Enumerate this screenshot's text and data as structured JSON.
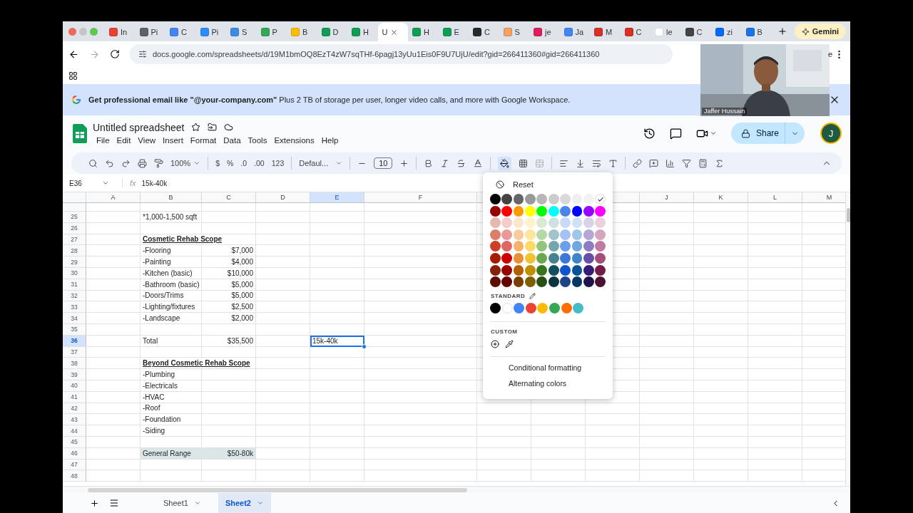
{
  "tabs": [
    {
      "label": "In",
      "color": "#ea4335",
      "selected": false
    },
    {
      "label": "Pi",
      "color": "#5f6368",
      "selected": false
    },
    {
      "label": "C",
      "color": "#4285f4",
      "selected": false
    },
    {
      "label": "Pi",
      "color": "#2d8cff",
      "selected": false
    },
    {
      "label": "S",
      "color": "#3c8ce7",
      "selected": false
    },
    {
      "label": "P",
      "color": "#34a853",
      "selected": false
    },
    {
      "label": "B",
      "color": "#fbbc04",
      "selected": false
    },
    {
      "label": "D",
      "color": "#0f9d58",
      "selected": false
    },
    {
      "label": "H",
      "color": "#0f9d58",
      "selected": false
    },
    {
      "label": "U",
      "selected": true
    },
    {
      "label": "H",
      "color": "#0f9d58",
      "selected": false
    },
    {
      "label": "E",
      "color": "#0f9d58",
      "selected": false
    },
    {
      "label": "C",
      "color": "#2a2a2a",
      "selected": false
    },
    {
      "label": "S",
      "color": "#f4a261",
      "selected": false
    },
    {
      "label": "je",
      "color": "#e01e5a",
      "selected": false
    },
    {
      "label": "Ja",
      "color": "#4285f4",
      "selected": false
    },
    {
      "label": "M",
      "color": "#d93025",
      "selected": false
    },
    {
      "label": "C",
      "color": "#d93025",
      "selected": false
    },
    {
      "label": "le",
      "color": "#ffffff",
      "selected": false
    },
    {
      "label": "C",
      "color": "#444444",
      "selected": false
    },
    {
      "label": "zi",
      "color": "#006aff",
      "selected": false
    },
    {
      "label": "B",
      "color": "#1a73e8",
      "selected": false
    }
  ],
  "gemini": "Gemini",
  "address_bar": {
    "url": "docs.google.com/spreadsheets/d/19M1bmOQ8EzT4zW7sqTHf-6pagj13yUu1Eis0F9U7UjU/edit?gid=266411360#gid=266411360",
    "chip_fragment": "e"
  },
  "banner": {
    "text": "**Get professional email like \"@your-company.com\"** Plus 2 TB of storage per user, longer video calls, and more with Google Workspace."
  },
  "video": {
    "name": "Jaffer Hussain"
  },
  "document": {
    "title": "Untitled spreadsheet",
    "menu": [
      "File",
      "Edit",
      "View",
      "Insert",
      "Format",
      "Data",
      "Tools",
      "Extensions",
      "Help"
    ],
    "share": "Share",
    "avatar": "J"
  },
  "toolbar": {
    "zoom": "100%",
    "currency": "$",
    "percent": "%",
    "decrease_decimals": ".0",
    "increase_decimals": ".00",
    "number_format": "123",
    "font": "Defaul...",
    "font_size": "10",
    "fill_menu_open": true
  },
  "formula_bar": {
    "cell": "E36",
    "fx": "fx",
    "value": "15k-40k"
  },
  "columns": [
    {
      "label": "A",
      "selected": false
    },
    {
      "label": "B",
      "selected": false
    },
    {
      "label": "C",
      "selected": false
    },
    {
      "label": "D",
      "selected": false
    },
    {
      "label": "E",
      "selected": true
    },
    {
      "label": "F",
      "selected": false
    },
    null,
    null,
    null,
    {
      "label": "J",
      "selected": false
    },
    {
      "label": "K",
      "selected": false
    },
    {
      "label": "L",
      "selected": false
    },
    {
      "label": "M",
      "selected": false
    }
  ],
  "rows": [
    {
      "number": "25",
      "selected": false,
      "cells": [
        null,
        {
          "text": "*1,000-1,500 sqft",
          "kind": "text",
          "shaded": false,
          "selected": false
        }
      ]
    },
    {
      "number": "26",
      "selected": false,
      "cells": []
    },
    {
      "number": "27",
      "selected": false,
      "cells": [
        null,
        {
          "text": "Cosmetic Rehab Scope",
          "kind": "heading",
          "shaded": false,
          "selected": false
        }
      ]
    },
    {
      "number": "28",
      "selected": false,
      "cells": [
        null,
        {
          "text": "-Flooring",
          "kind": "text",
          "shaded": false,
          "selected": false
        },
        {
          "text": "$7,000",
          "kind": "number",
          "shaded": false,
          "selected": false
        }
      ]
    },
    {
      "number": "29",
      "selected": false,
      "cells": [
        null,
        {
          "text": "-Painting",
          "kind": "text",
          "shaded": false,
          "selected": false
        },
        {
          "text": "$4,000",
          "kind": "number",
          "shaded": false,
          "selected": false
        }
      ]
    },
    {
      "number": "30",
      "selected": false,
      "cells": [
        null,
        {
          "text": "-Kitchen (basic)",
          "kind": "text",
          "shaded": false,
          "selected": false
        },
        {
          "text": "$10,000",
          "kind": "number",
          "shaded": false,
          "selected": false
        }
      ]
    },
    {
      "number": "31",
      "selected": false,
      "cells": [
        null,
        {
          "text": "-Bathroom (basic)",
          "kind": "text",
          "shaded": false,
          "selected": false
        },
        {
          "text": "$5,000",
          "kind": "number",
          "shaded": false,
          "selected": false
        }
      ]
    },
    {
      "number": "32",
      "selected": false,
      "cells": [
        null,
        {
          "text": "-Doors/Trims",
          "kind": "text",
          "shaded": false,
          "selected": false
        },
        {
          "text": "$5,000",
          "kind": "number",
          "shaded": false,
          "selected": false
        }
      ]
    },
    {
      "number": "33",
      "selected": false,
      "cells": [
        null,
        {
          "text": "-Lighting/fixtures",
          "kind": "text",
          "shaded": false,
          "selected": false
        },
        {
          "text": "$2,500",
          "kind": "number",
          "shaded": false,
          "selected": false
        }
      ]
    },
    {
      "number": "34",
      "selected": false,
      "cells": [
        null,
        {
          "text": "-Landscape",
          "kind": "text",
          "shaded": false,
          "selected": false
        },
        {
          "text": "$2,000",
          "kind": "number",
          "shaded": false,
          "selected": false
        }
      ]
    },
    {
      "number": "35",
      "selected": false,
      "cells": []
    },
    {
      "number": "36",
      "selected": true,
      "cells": [
        null,
        {
          "text": "Total",
          "kind": "text",
          "shaded": false,
          "selected": false
        },
        {
          "text": "$35,500",
          "kind": "number",
          "shaded": false,
          "selected": false
        },
        null,
        {
          "text": "15k-40k",
          "kind": "text",
          "shaded": false,
          "selected": true
        }
      ]
    },
    {
      "number": "37",
      "selected": false,
      "cells": []
    },
    {
      "number": "38",
      "selected": false,
      "cells": [
        null,
        {
          "text": "Beyond Cosmetic Rehab Scope",
          "kind": "heading",
          "shaded": false,
          "selected": false
        }
      ]
    },
    {
      "number": "39",
      "selected": false,
      "cells": [
        null,
        {
          "text": "-Plumbing",
          "kind": "text",
          "shaded": false,
          "selected": false
        }
      ]
    },
    {
      "number": "40",
      "selected": false,
      "cells": [
        null,
        {
          "text": "-Electricals",
          "kind": "text",
          "shaded": false,
          "selected": false
        }
      ]
    },
    {
      "number": "41",
      "selected": false,
      "cells": [
        null,
        {
          "text": "-HVAC",
          "kind": "text",
          "shaded": false,
          "selected": false
        }
      ]
    },
    {
      "number": "42",
      "selected": false,
      "cells": [
        null,
        {
          "text": "-Roof",
          "kind": "text",
          "shaded": false,
          "selected": false
        }
      ]
    },
    {
      "number": "43",
      "selected": false,
      "cells": [
        null,
        {
          "text": "-Foundation",
          "kind": "text",
          "shaded": false,
          "selected": false
        }
      ]
    },
    {
      "number": "44",
      "selected": false,
      "cells": [
        null,
        {
          "text": "-Siding",
          "kind": "text",
          "shaded": false,
          "selected": false
        }
      ]
    },
    {
      "number": "45",
      "selected": false,
      "cells": []
    },
    {
      "number": "46",
      "selected": false,
      "cells": [
        null,
        {
          "text": "General Range",
          "kind": "text",
          "shaded": true,
          "selected": false
        },
        {
          "text": "$50-80k",
          "kind": "number",
          "shaded": true,
          "selected": false
        }
      ]
    },
    {
      "number": "47",
      "selected": false,
      "cells": []
    },
    {
      "number": "48",
      "selected": false,
      "cells": []
    }
  ],
  "palette": {
    "reset": "Reset",
    "rows": [
      [
        {
          "color": "#000000",
          "selected": false
        },
        {
          "color": "#434343",
          "selected": false
        },
        {
          "color": "#666666",
          "selected": false
        },
        {
          "color": "#999999",
          "selected": false
        },
        {
          "color": "#b7b7b7",
          "selected": false
        },
        {
          "color": "#cccccc",
          "selected": false
        },
        {
          "color": "#d9d9d9",
          "selected": false
        },
        {
          "color": "#efefef",
          "selected": false
        },
        {
          "color": "#f3f3f3",
          "selected": false
        },
        {
          "color": "#ffffff",
          "selected": true
        }
      ],
      [
        {
          "color": "#980000",
          "selected": false
        },
        {
          "color": "#ff0000",
          "selected": false
        },
        {
          "color": "#ff9900",
          "selected": false
        },
        {
          "color": "#ffff00",
          "selected": false
        },
        {
          "color": "#00ff00",
          "selected": false
        },
        {
          "color": "#00ffff",
          "selected": false
        },
        {
          "color": "#4a86e8",
          "selected": false
        },
        {
          "color": "#0000ff",
          "selected": false
        },
        {
          "color": "#9900ff",
          "selected": false
        },
        {
          "color": "#ff00ff",
          "selected": false
        }
      ],
      [
        {
          "color": "#e6b8af",
          "selected": false
        },
        {
          "color": "#f4cccc",
          "selected": false
        },
        {
          "color": "#fce5cd",
          "selected": false
        },
        {
          "color": "#fff2cc",
          "selected": false
        },
        {
          "color": "#d9ead3",
          "selected": false
        },
        {
          "color": "#d0e0e3",
          "selected": false
        },
        {
          "color": "#c9daf8",
          "selected": false
        },
        {
          "color": "#cfe2f3",
          "selected": false
        },
        {
          "color": "#d9d2e9",
          "selected": false
        },
        {
          "color": "#ead1dc",
          "selected": false
        }
      ],
      [
        {
          "color": "#dd7e6b",
          "selected": false
        },
        {
          "color": "#ea9999",
          "selected": false
        },
        {
          "color": "#f9cb9c",
          "selected": false
        },
        {
          "color": "#ffe599",
          "selected": false
        },
        {
          "color": "#b6d7a8",
          "selected": false
        },
        {
          "color": "#a2c4c9",
          "selected": false
        },
        {
          "color": "#a4c2f4",
          "selected": false
        },
        {
          "color": "#9fc5e8",
          "selected": false
        },
        {
          "color": "#b4a7d6",
          "selected": false
        },
        {
          "color": "#d5a6bd",
          "selected": false
        }
      ],
      [
        {
          "color": "#cc4125",
          "selected": false
        },
        {
          "color": "#e06666",
          "selected": false
        },
        {
          "color": "#f6b26b",
          "selected": false
        },
        {
          "color": "#ffd966",
          "selected": false
        },
        {
          "color": "#93c47d",
          "selected": false
        },
        {
          "color": "#76a5af",
          "selected": false
        },
        {
          "color": "#6d9eeb",
          "selected": false
        },
        {
          "color": "#6fa8dc",
          "selected": false
        },
        {
          "color": "#8e7cc3",
          "selected": false
        },
        {
          "color": "#c27ba0",
          "selected": false
        }
      ],
      [
        {
          "color": "#a61c00",
          "selected": false
        },
        {
          "color": "#cc0000",
          "selected": false
        },
        {
          "color": "#e69138",
          "selected": false
        },
        {
          "color": "#f1c232",
          "selected": false
        },
        {
          "color": "#6aa84f",
          "selected": false
        },
        {
          "color": "#45818e",
          "selected": false
        },
        {
          "color": "#3c78d8",
          "selected": false
        },
        {
          "color": "#3d85c6",
          "selected": false
        },
        {
          "color": "#674ea7",
          "selected": false
        },
        {
          "color": "#a64d79",
          "selected": false
        }
      ],
      [
        {
          "color": "#85200c",
          "selected": false
        },
        {
          "color": "#990000",
          "selected": false
        },
        {
          "color": "#b45f06",
          "selected": false
        },
        {
          "color": "#bf9000",
          "selected": false
        },
        {
          "color": "#38761d",
          "selected": false
        },
        {
          "color": "#134f5c",
          "selected": false
        },
        {
          "color": "#1155cc",
          "selected": false
        },
        {
          "color": "#0b5394",
          "selected": false
        },
        {
          "color": "#351c75",
          "selected": false
        },
        {
          "color": "#741b47",
          "selected": false
        }
      ],
      [
        {
          "color": "#5b0f00",
          "selected": false
        },
        {
          "color": "#660000",
          "selected": false
        },
        {
          "color": "#783f04",
          "selected": false
        },
        {
          "color": "#7f6000",
          "selected": false
        },
        {
          "color": "#274e13",
          "selected": false
        },
        {
          "color": "#0c343d",
          "selected": false
        },
        {
          "color": "#1c4587",
          "selected": false
        },
        {
          "color": "#073763",
          "selected": false
        },
        {
          "color": "#20124d",
          "selected": false
        },
        {
          "color": "#4c1130",
          "selected": false
        }
      ]
    ],
    "standard_label": "STANDARD",
    "standard": [
      {
        "color": "#000000",
        "selected": false
      },
      {
        "color": "#ffffff",
        "selected": false
      },
      {
        "color": "#4285f4",
        "selected": false
      },
      {
        "color": "#ea4335",
        "selected": false
      },
      {
        "color": "#fbbc04",
        "selected": false
      },
      {
        "color": "#34a853",
        "selected": false
      },
      {
        "color": "#ff6d01",
        "selected": false
      },
      {
        "color": "#46bdc6",
        "selected": false
      }
    ],
    "custom_label": "CUSTOM",
    "options": [
      "Conditional formatting",
      "Alternating colors"
    ]
  },
  "sheets": [
    {
      "label": "Sheet1",
      "selected": false
    },
    {
      "label": "Sheet2",
      "selected": true
    }
  ]
}
